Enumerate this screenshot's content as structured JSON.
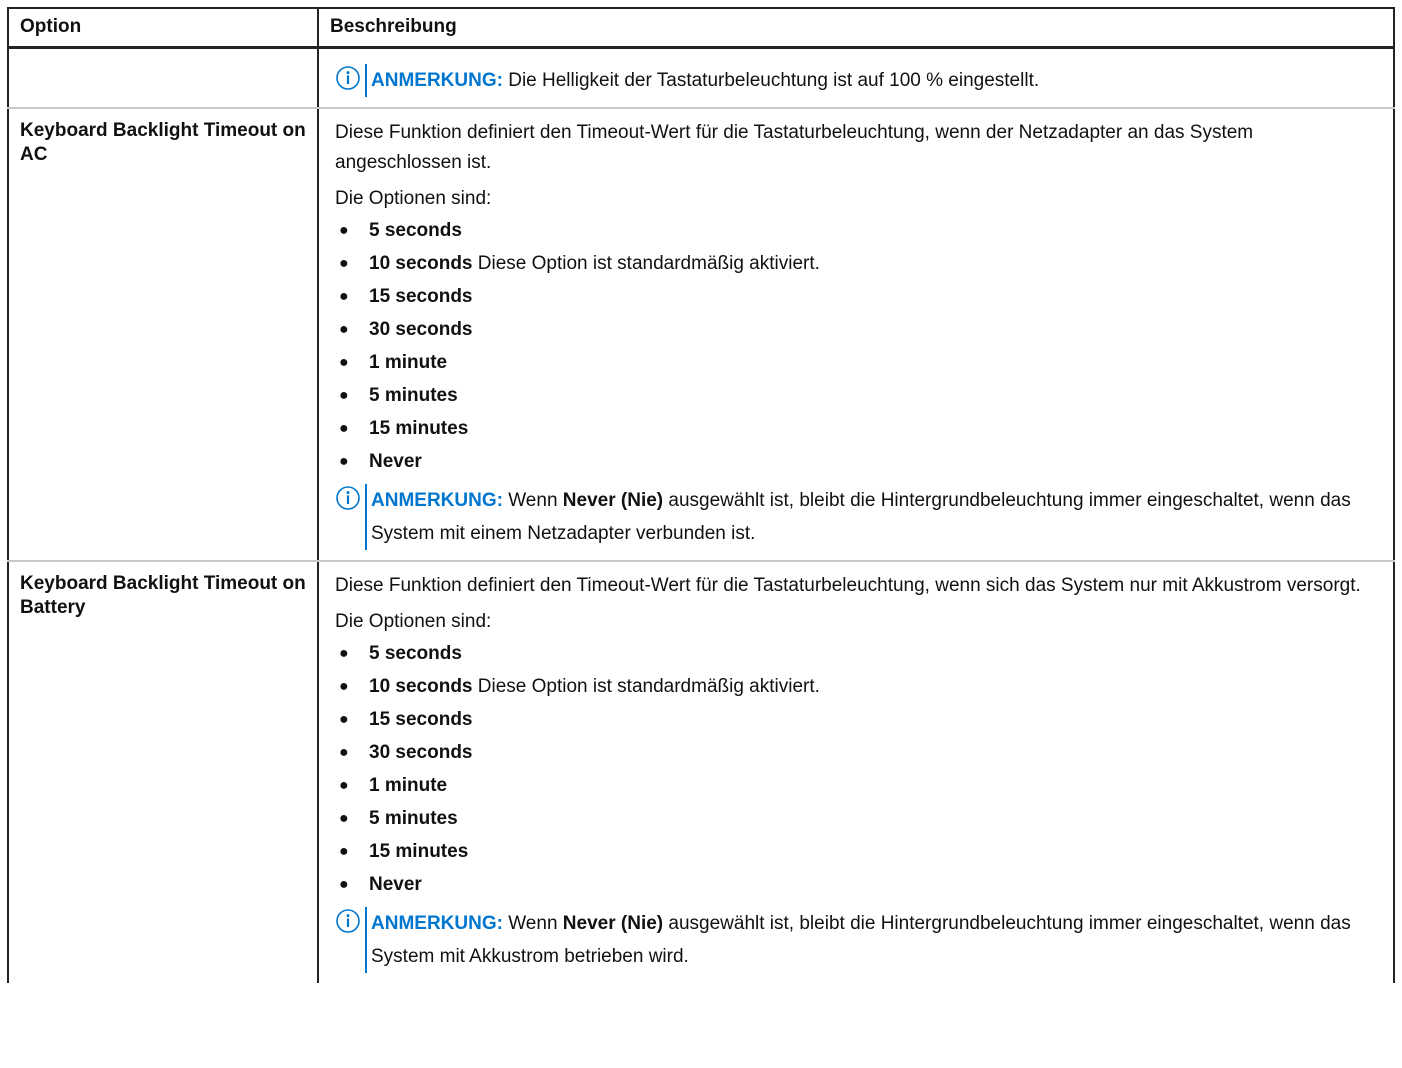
{
  "colors": {
    "note_accent": "#0076ce",
    "rule": "#222222",
    "light_rule": "#c8c8c8"
  },
  "table": {
    "header": {
      "option": "Option",
      "description": "Beschreibung"
    },
    "rows": [
      {
        "option": "",
        "note": {
          "icon": "info-icon",
          "label": "ANMERKUNG:",
          "text": " Die Helligkeit der Tastaturbeleuchtung ist auf 100 % eingestellt."
        }
      },
      {
        "option": "Keyboard Backlight Timeout on AC",
        "description": "Diese Funktion definiert den Timeout-Wert für die Tastaturbeleuchtung, wenn der Netzadapter an das System angeschlossen ist.",
        "options_intro": "Die Optionen sind:",
        "options": [
          {
            "name": "5 seconds",
            "suffix": ""
          },
          {
            "name": "10 seconds",
            "suffix": " Diese Option ist standardmäßig aktiviert."
          },
          {
            "name": "15 seconds",
            "suffix": ""
          },
          {
            "name": "30 seconds",
            "suffix": ""
          },
          {
            "name": "1 minute",
            "suffix": ""
          },
          {
            "name": "5 minutes",
            "suffix": ""
          },
          {
            "name": "15 minutes",
            "suffix": ""
          },
          {
            "name": "Never",
            "suffix": ""
          }
        ],
        "note": {
          "icon": "info-icon",
          "label": "ANMERKUNG:",
          "pre": " Wenn ",
          "bold": "Never (Nie)",
          "post": " ausgewählt ist, bleibt die Hintergrundbeleuchtung immer eingeschaltet, wenn das System mit einem Netzadapter verbunden ist."
        }
      },
      {
        "option": "Keyboard Backlight Timeout on Battery",
        "description": "Diese Funktion definiert den Timeout-Wert für die Tastaturbeleuchtung, wenn sich das System nur mit Akkustrom versorgt.",
        "options_intro": "Die Optionen sind:",
        "options": [
          {
            "name": "5 seconds",
            "suffix": ""
          },
          {
            "name": "10 seconds",
            "suffix": " Diese Option ist standardmäßig aktiviert."
          },
          {
            "name": "15 seconds",
            "suffix": ""
          },
          {
            "name": "30 seconds",
            "suffix": ""
          },
          {
            "name": "1 minute",
            "suffix": ""
          },
          {
            "name": "5 minutes",
            "suffix": ""
          },
          {
            "name": "15 minutes",
            "suffix": ""
          },
          {
            "name": "Never",
            "suffix": ""
          }
        ],
        "note": {
          "icon": "info-icon",
          "label": "ANMERKUNG:",
          "pre": " Wenn ",
          "bold": "Never (Nie)",
          "post": " ausgewählt ist, bleibt die Hintergrundbeleuchtung immer eingeschaltet, wenn das System mit Akkustrom betrieben wird."
        }
      }
    ]
  }
}
